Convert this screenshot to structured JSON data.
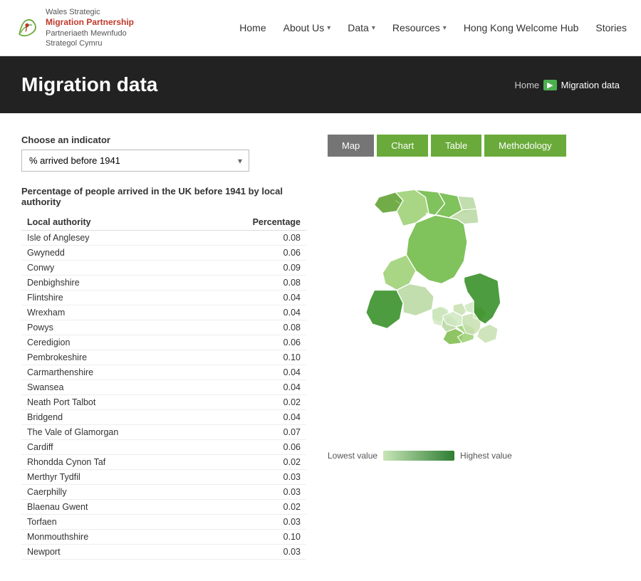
{
  "header": {
    "logo_line1": "Wales Strategic",
    "logo_line2": "Migration Partnership",
    "logo_line3": "Partneriaeth Mewnfudo",
    "logo_line4": "Strategol Cymru",
    "nav": [
      {
        "label": "Home",
        "has_dropdown": false
      },
      {
        "label": "About Us",
        "has_dropdown": true
      },
      {
        "label": "Data",
        "has_dropdown": true
      },
      {
        "label": "Resources",
        "has_dropdown": true
      },
      {
        "label": "Hong Kong Welcome Hub",
        "has_dropdown": false
      },
      {
        "label": "Stories",
        "has_dropdown": false
      }
    ]
  },
  "hero": {
    "title": "Migration data",
    "breadcrumb_home": "Home",
    "breadcrumb_current": "Migration data"
  },
  "indicator": {
    "label": "Choose an indicator",
    "selected": "% arrived before 1941"
  },
  "tabs": [
    {
      "label": "Map",
      "active": true
    },
    {
      "label": "Chart",
      "active": false
    },
    {
      "label": "Table",
      "active": false
    },
    {
      "label": "Methodology",
      "active": false
    }
  ],
  "table": {
    "title": "Percentage of people arrived in the UK before 1941 by local authority",
    "col1": "Local authority",
    "col2": "Percentage",
    "rows": [
      {
        "area": "Isle of Anglesey",
        "value": "0.08"
      },
      {
        "area": "Gwynedd",
        "value": "0.06"
      },
      {
        "area": "Conwy",
        "value": "0.09"
      },
      {
        "area": "Denbighshire",
        "value": "0.08"
      },
      {
        "area": "Flintshire",
        "value": "0.04"
      },
      {
        "area": "Wrexham",
        "value": "0.04"
      },
      {
        "area": "Powys",
        "value": "0.08"
      },
      {
        "area": "Ceredigion",
        "value": "0.06"
      },
      {
        "area": "Pembrokeshire",
        "value": "0.10"
      },
      {
        "area": "Carmarthenshire",
        "value": "0.04"
      },
      {
        "area": "Swansea",
        "value": "0.04"
      },
      {
        "area": "Neath Port Talbot",
        "value": "0.02"
      },
      {
        "area": "Bridgend",
        "value": "0.04"
      },
      {
        "area": "The Vale of Glamorgan",
        "value": "0.07"
      },
      {
        "area": "Cardiff",
        "value": "0.06"
      },
      {
        "area": "Rhondda Cynon Taf",
        "value": "0.02"
      },
      {
        "area": "Merthyr Tydfil",
        "value": "0.03"
      },
      {
        "area": "Caerphilly",
        "value": "0.03"
      },
      {
        "area": "Blaenau Gwent",
        "value": "0.02"
      },
      {
        "area": "Torfaen",
        "value": "0.03"
      },
      {
        "area": "Monmouthshire",
        "value": "0.10"
      },
      {
        "area": "Newport",
        "value": "0.03"
      }
    ]
  },
  "legend": {
    "lowest": "Lowest value",
    "highest": "Highest value"
  },
  "colors": {
    "accent_green": "#6aaa3a",
    "dark_green": "#2e7d32",
    "tab_active": "#757575",
    "hero_bg": "#222222"
  }
}
